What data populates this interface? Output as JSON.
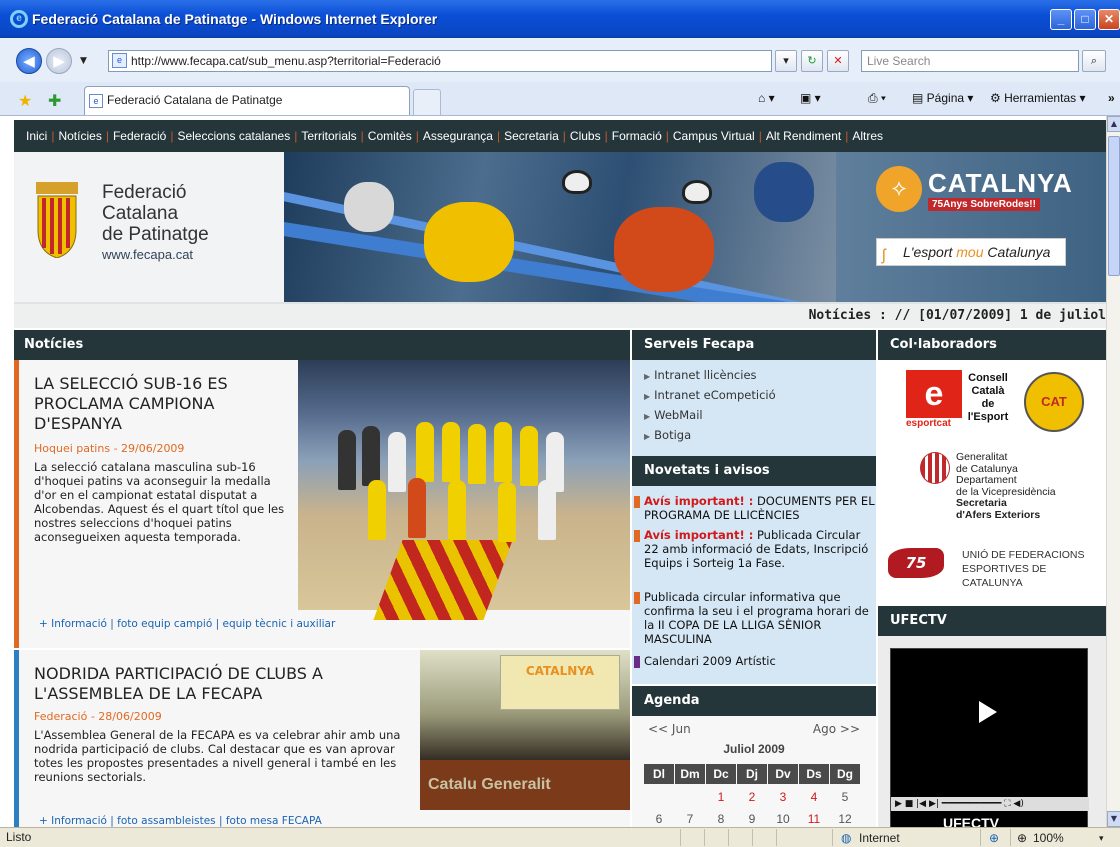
{
  "window": {
    "title": "Federació Catalana de Patinatge - Windows Internet Explorer",
    "address": "http://www.fecapa.cat/sub_menu.asp?territorial=Federació",
    "search_placeholder": "Live Search",
    "tab_title": "Federació Catalana de Patinatge",
    "page_menu": "Página",
    "tools_menu": "Herramientas",
    "status_text": "Listo",
    "zone": "Internet",
    "zoom": "100%"
  },
  "nav": [
    "Inici",
    "Notícies",
    "Federació",
    "Seleccions catalanes",
    "Territorials",
    "Comitès",
    "Assegurança",
    "Secretaria",
    "Clubs",
    "Formació",
    "Campus Virtual",
    "Alt Rendiment",
    "Altres"
  ],
  "banner": {
    "fed_name_1": "Federació",
    "fed_name_2": "Catalana",
    "fed_name_3": "de Patinatge",
    "fed_url": "www.fecapa.cat",
    "cat_word": "CATALNYA",
    "cat_sub": "75Anys SobreRodes!!",
    "esport_mou_1": "L'esport ",
    "esport_mou_2": "mou",
    "esport_mou_3": " Catalunya"
  },
  "ticker": "Notícies :  //  [01/07/2009]  1 de juliol",
  "news": {
    "header": "Notícies",
    "articles": [
      {
        "title": "LA SELECCIÓ SUB-16 ES PROCLAMA CAMPIONA D'ESPANYA",
        "category": "Hoquei patins - 29/06/2009",
        "body": "La selecció catalana masculina sub-16 d'hoquei patins va aconseguir la medalla d'or en el campionat estatal disputat a Alcobendas. Aquest és el quart títol que les nostres seleccions d'hoquei patins aconsegueixen aquesta temporada.",
        "links": "+ Informació | foto equip campió | equip tècnic i auxiliar"
      },
      {
        "title": "NODRIDA PARTICIPACIÓ DE CLUBS A L'ASSEMBLEA DE LA FECAPA",
        "category": "Federació - 28/06/2009",
        "body": "L'Assemblea General de la FECAPA es va celebrar ahir amb una nodrida participació de clubs. Cal destacar que es van aprovar totes les propostes presentades a nivell general i també en les reunions sectorials.",
        "links": "+ Informació | foto assambleistes | foto mesa FECAPA"
      }
    ],
    "meeting_screen": "CATALNYA",
    "meeting_table": "Catalu    Generalit"
  },
  "services": {
    "header": "Serveis Fecapa",
    "items": [
      "Intranet llicències",
      "Intranet eCompetició",
      "WebMail",
      "Botiga"
    ]
  },
  "novetats": {
    "header": "Novetats i avisos",
    "items": [
      {
        "alert": "Avís important! :",
        "text": " DOCUMENTS PER EL PROGRAMA DE LLICÈNCIES"
      },
      {
        "alert": "Avís important! :",
        "text": " Publicada Circular 22 amb informació de Edats, Inscripció Equips i Sorteig 1a Fase."
      },
      {
        "alert": "",
        "text": "Publicada circular informativa que confirma la seu i el programa horari de la II COPA DE LA LLIGA SÈNIOR MASCULINA"
      },
      {
        "alert": "",
        "text": "Calendari 2009 Artístic"
      }
    ]
  },
  "agenda": {
    "header": "Agenda",
    "prev": "<< Jun",
    "next": "Ago >>",
    "month": "Juliol 2009",
    "days": [
      "Dl",
      "Dm",
      "Dc",
      "Dj",
      "Dv",
      "Ds",
      "Dg"
    ],
    "row1": [
      "",
      "",
      "1",
      "2",
      "3",
      "4",
      "5"
    ],
    "row2": [
      "6",
      "7",
      "8",
      "9",
      "10",
      "11",
      "12"
    ]
  },
  "collaborators": {
    "header": "Col·laboradors",
    "consell": "Consell Català de l'Esport",
    "esportcat": "esportcat",
    "cat_seal": "CAT",
    "gencat_1": "Generalitat",
    "gencat_2": "de Catalunya",
    "gencat_3": "Departament",
    "gencat_4": "de la Vicepresidència",
    "gencat_5": "Secretaria",
    "gencat_6": "d'Afers Exteriors",
    "ufec_75": "75",
    "ufec_1": "UNIÓ DE FEDERACIONS",
    "ufec_2": "ESPORTIVES DE CATALUNYA"
  },
  "ufectv": {
    "header": "UFECTV",
    "brand": "UFECTV"
  },
  "colors": {
    "nav_bg": "#25363b",
    "accent_orange": "#e06a24",
    "accent_blue": "#2c7fc0",
    "panel_blue": "#d5e7f5",
    "alert_red": "#d11a1a"
  }
}
